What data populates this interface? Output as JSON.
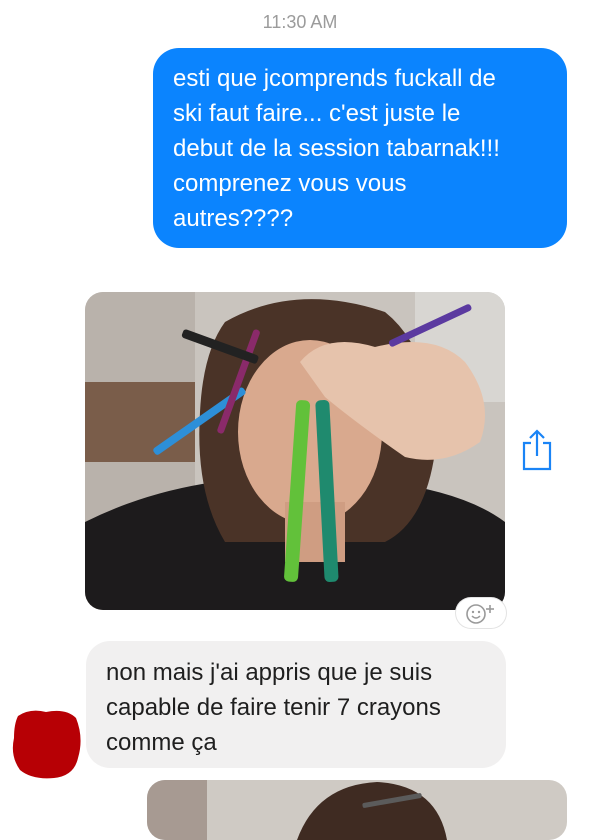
{
  "conversation": {
    "timestamp": "11:30 AM",
    "messages": [
      {
        "direction": "outgoing",
        "type": "text",
        "lines": [
          "esti que jcomprends fuckall de",
          "ski faut faire... c'est juste le",
          "debut de la session tabarnak!!!",
          "comprenez vous vous",
          "autres????"
        ]
      },
      {
        "direction": "incoming",
        "type": "photo"
      },
      {
        "direction": "incoming",
        "type": "text",
        "lines": [
          "non mais j'ai appris que je suis",
          "capable de faire tenir 7 crayons",
          "comme ça"
        ]
      },
      {
        "direction": "incoming",
        "type": "photo"
      }
    ]
  },
  "icons": {
    "share": "share-icon",
    "reaction": "add-reaction-icon",
    "avatar": "avatar-redacted"
  },
  "colors": {
    "outgoing_bubble": "#0b84fe",
    "incoming_bubble": "#f1f0f0",
    "timestamp": "#9b9b9b",
    "share_icon": "#1a84f6",
    "avatar_redaction": "#b70005"
  }
}
